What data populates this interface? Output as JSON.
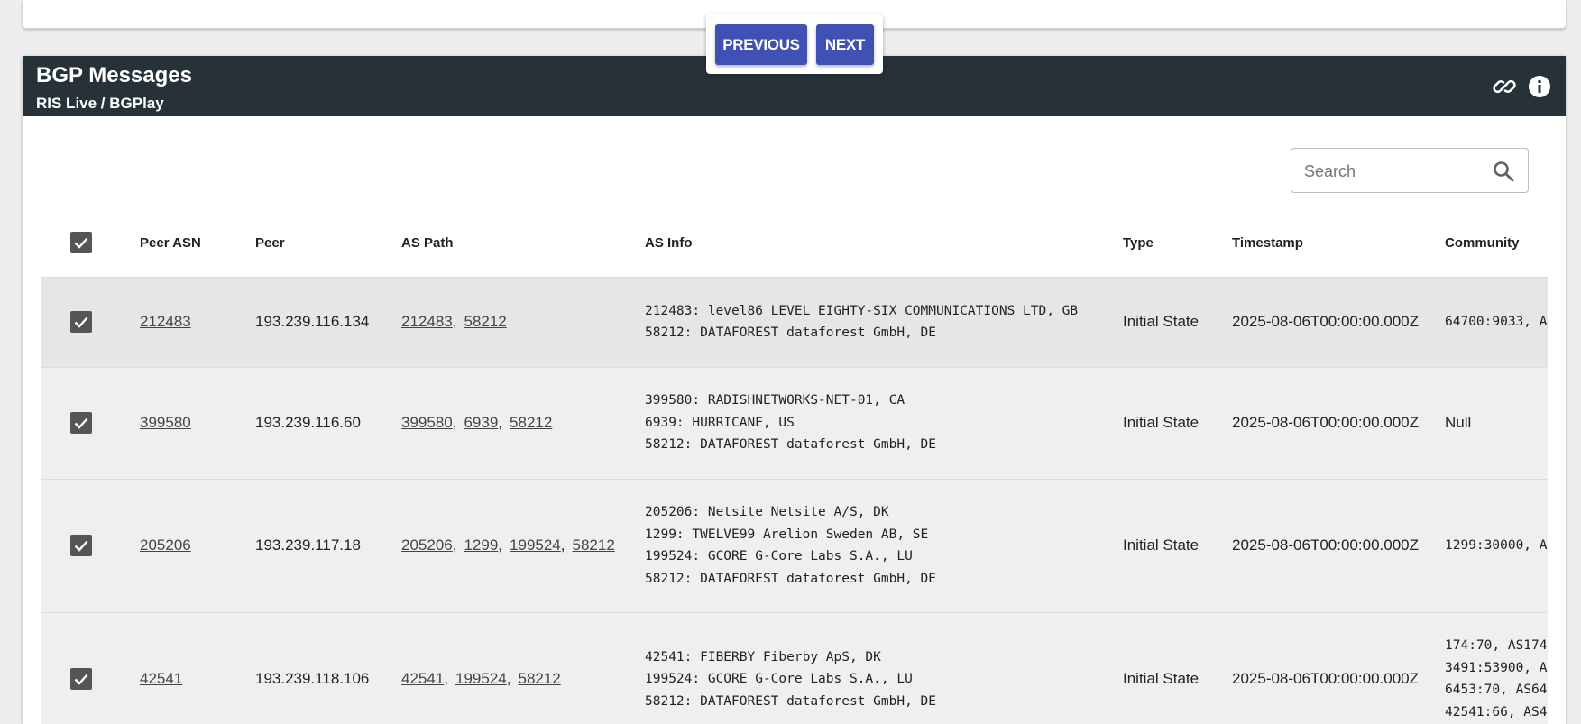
{
  "pager": {
    "previous_label": "PREVIOUS",
    "next_label": "NEXT"
  },
  "widget": {
    "title": "BGP Messages",
    "subtitle": "RIS Live / BGPlay",
    "link_icon": "link-icon",
    "info_icon": "info-icon"
  },
  "search": {
    "placeholder": "Search",
    "value": "",
    "icon": "search-icon"
  },
  "table": {
    "columns": [
      "Peer ASN",
      "Peer",
      "AS Path",
      "AS Info",
      "Type",
      "Timestamp",
      "Community"
    ],
    "rows": [
      {
        "peer_asn": "212483",
        "peer": "193.239.116.134",
        "as_path": [
          "212483",
          "58212"
        ],
        "as_info": [
          "212483: level86 LEVEL EIGHTY-SIX COMMUNICATIONS LTD, GB",
          "58212: DATAFOREST dataforest GmbH, DE"
        ],
        "type": "Initial State",
        "timestamp": "2025-08-06T00:00:00.000Z",
        "community": [
          "64700:9033, A"
        ]
      },
      {
        "peer_asn": "399580",
        "peer": "193.239.116.60",
        "as_path": [
          "399580",
          "6939",
          "58212"
        ],
        "as_info": [
          "399580: RADISHNETWORKS-NET-01, CA",
          "6939: HURRICANE, US",
          "58212: DATAFOREST dataforest GmbH, DE"
        ],
        "type": "Initial State",
        "timestamp": "2025-08-06T00:00:00.000Z",
        "community": [
          "Null"
        ]
      },
      {
        "peer_asn": "205206",
        "peer": "193.239.117.18",
        "as_path": [
          "205206",
          "1299",
          "199524",
          "58212"
        ],
        "as_info": [
          "205206: Netsite Netsite A/S, DK",
          "1299: TWELVE99 Arelion Sweden AB, SE",
          "199524: GCORE G-Core Labs S.A., LU",
          "58212: DATAFOREST dataforest GmbH, DE"
        ],
        "type": "Initial State",
        "timestamp": "2025-08-06T00:00:00.000Z",
        "community": [
          "1299:30000, A"
        ]
      },
      {
        "peer_asn": "42541",
        "peer": "193.239.118.106",
        "as_path": [
          "42541",
          "199524",
          "58212"
        ],
        "as_info": [
          "42541: FIBERBY Fiberby ApS, DK",
          "199524: GCORE G-Core Labs S.A., LU",
          "58212: DATAFOREST dataforest GmbH, DE"
        ],
        "type": "Initial State",
        "timestamp": "2025-08-06T00:00:00.000Z",
        "community": [
          "174:70, AS174",
          "3491:53900, A",
          "6453:70, AS64",
          "42541:66, AS4"
        ]
      }
    ]
  },
  "colors": {
    "header_bg": "#263238",
    "button_bg": "#3f51b5"
  }
}
